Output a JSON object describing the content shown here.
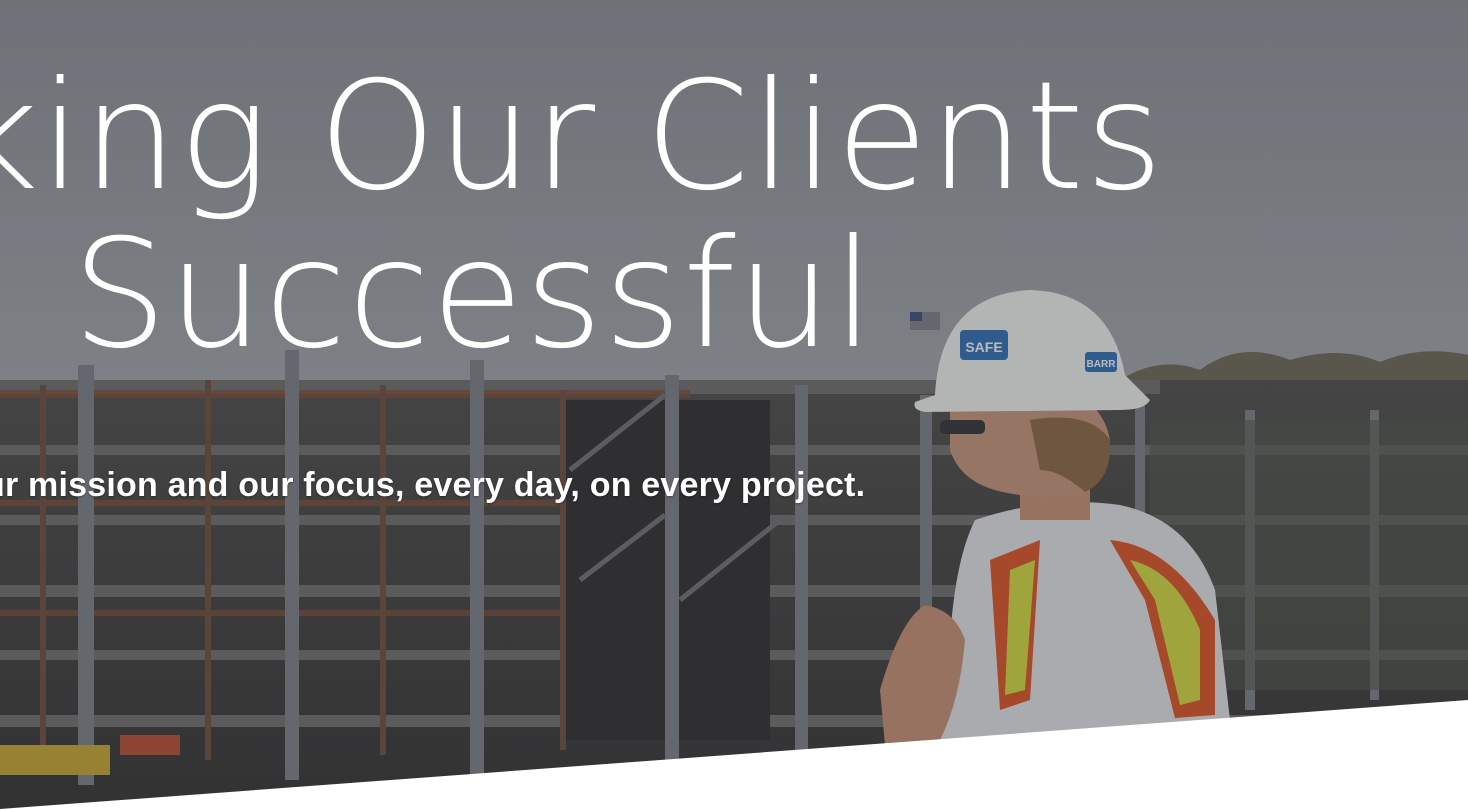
{
  "hero": {
    "headline_line1": "king Our Clients",
    "headline_line2": "Successful",
    "tagline": "ur mission and our focus, every day, on every project.",
    "hard_hat_badge": "SAFE",
    "hard_hat_badge_2": "BARR"
  },
  "colors": {
    "overlay": "#3a3d42",
    "sky": "#9a9ea3",
    "steel": "#5e6167",
    "rust": "#8a4a2a",
    "vest_orange": "#e0501e",
    "vest_yellow": "#d6de3a",
    "badge_blue": "#2b6cb5",
    "text": "#ffffff",
    "wedge": "#ffffff"
  }
}
